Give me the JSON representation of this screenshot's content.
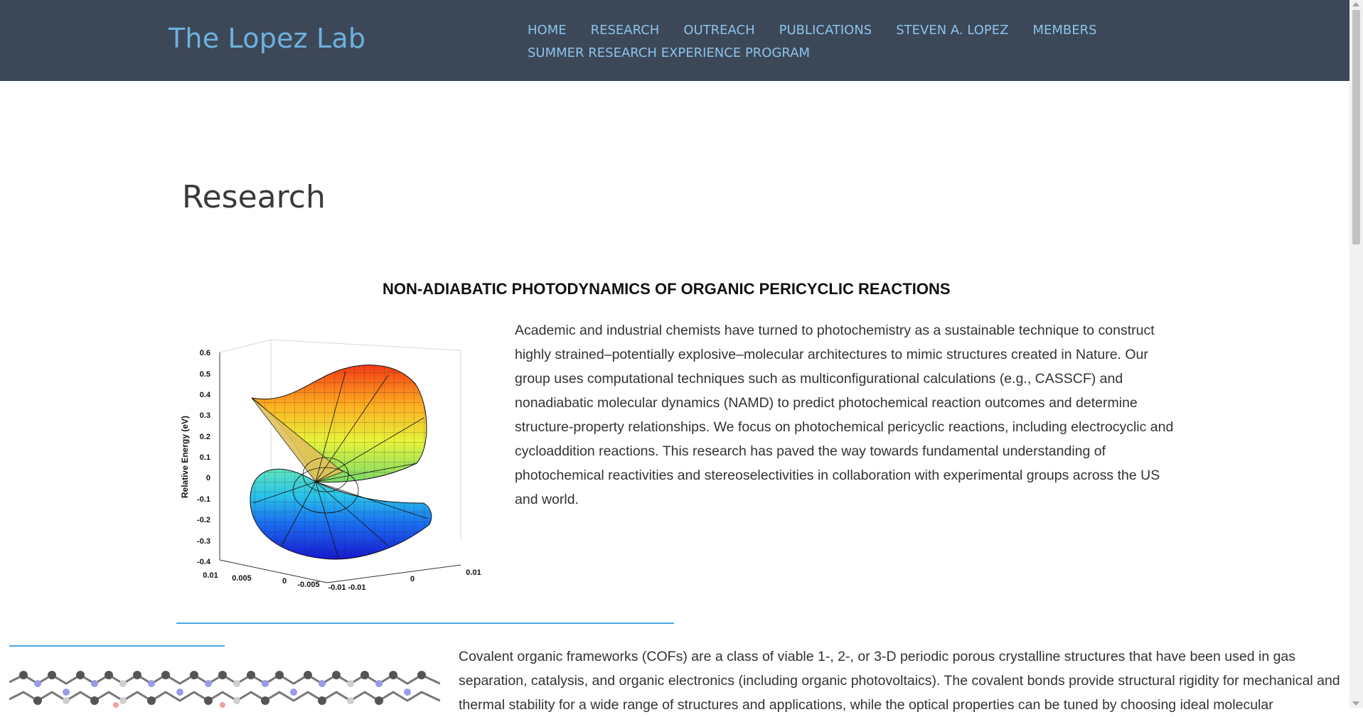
{
  "header": {
    "brand": "The Lopez Lab",
    "nav": {
      "home": "HOME",
      "research": "RESEARCH",
      "outreach": "OUTREACH",
      "publications": "PUBLICATIONS",
      "pi": "STEVEN A. LOPEZ",
      "members": "MEMBERS",
      "summer": "SUMMER RESEARCH EXPERIENCE PROGRAM"
    }
  },
  "main": {
    "title": "Research",
    "section1": {
      "title": "NON-ADIABATIC PHOTODYNAMICS OF ORGANIC PERICYCLIC REACTIONS",
      "body": "Academic and industrial chemists have turned to photochemistry as a sustainable technique to construct highly strained–potentially explosive–molecular architectures to mimic structures created in Nature. Our group uses computational techniques such as multiconfigurational calculations (e.g., CASSCF) and nonadiabatic molecular dynamics (NAMD) to predict photochemical reaction outcomes and determine structure-property relationships. We focus on photochemical pericyclic reactions, including electrocyclic and cycloaddition reactions. This research has paved the way towards fundamental understanding of photochemical reactivities and stereoselectivities in collaboration with experimental groups across the US and world.",
      "figure": {
        "ylabel": "Relative Energy (eV)",
        "yticks": [
          "0.6",
          "0.5",
          "0.4",
          "0.3",
          "0.2",
          "0.1",
          "0",
          "-0.1",
          "-0.2",
          "-0.3",
          "-0.4"
        ],
        "xticks": [
          "0.01",
          "0.005",
          "0",
          "-0.005",
          "-0.01"
        ],
        "zticks": [
          "-0.01",
          "0",
          "0.01"
        ]
      }
    },
    "section2": {
      "body": "Covalent organic frameworks (COFs) are a class of viable 1-, 2-, or 3-D periodic porous crystalline structures that have been used in gas separation, catalysis, and organic electronics (including organic photovoltaics). The covalent bonds provide structural rigidity for mechanical and thermal stability for a wide range of structures and applications, while the optical properties can be tuned by choosing ideal molecular"
    }
  },
  "colors": {
    "navbar": "#3c4858",
    "brand": "#6fb1de",
    "nav_link": "#8cc2ea",
    "rule": "#4aa8e0"
  }
}
